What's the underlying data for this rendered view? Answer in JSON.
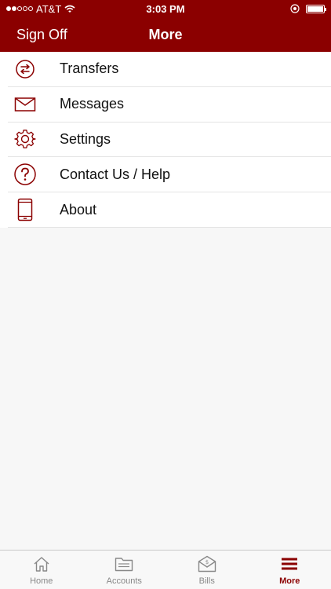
{
  "status_bar": {
    "carrier": "AT&T",
    "time": "3:03 PM"
  },
  "nav": {
    "left_label": "Sign Off",
    "title": "More"
  },
  "menu": {
    "items": [
      {
        "label": "Transfers",
        "icon": "transfer-arrows-icon"
      },
      {
        "label": "Messages",
        "icon": "envelope-icon"
      },
      {
        "label": "Settings",
        "icon": "gear-icon"
      },
      {
        "label": "Contact Us / Help",
        "icon": "question-icon"
      },
      {
        "label": "About",
        "icon": "phone-icon"
      }
    ]
  },
  "tabs": [
    {
      "label": "Home",
      "icon": "home-icon",
      "active": false
    },
    {
      "label": "Accounts",
      "icon": "folder-icon",
      "active": false
    },
    {
      "label": "Bills",
      "icon": "bill-envelope-icon",
      "active": false
    },
    {
      "label": "More",
      "icon": "hamburger-icon",
      "active": true
    }
  ],
  "colors": {
    "brand": "#8b0000",
    "tab_inactive": "#888888"
  }
}
